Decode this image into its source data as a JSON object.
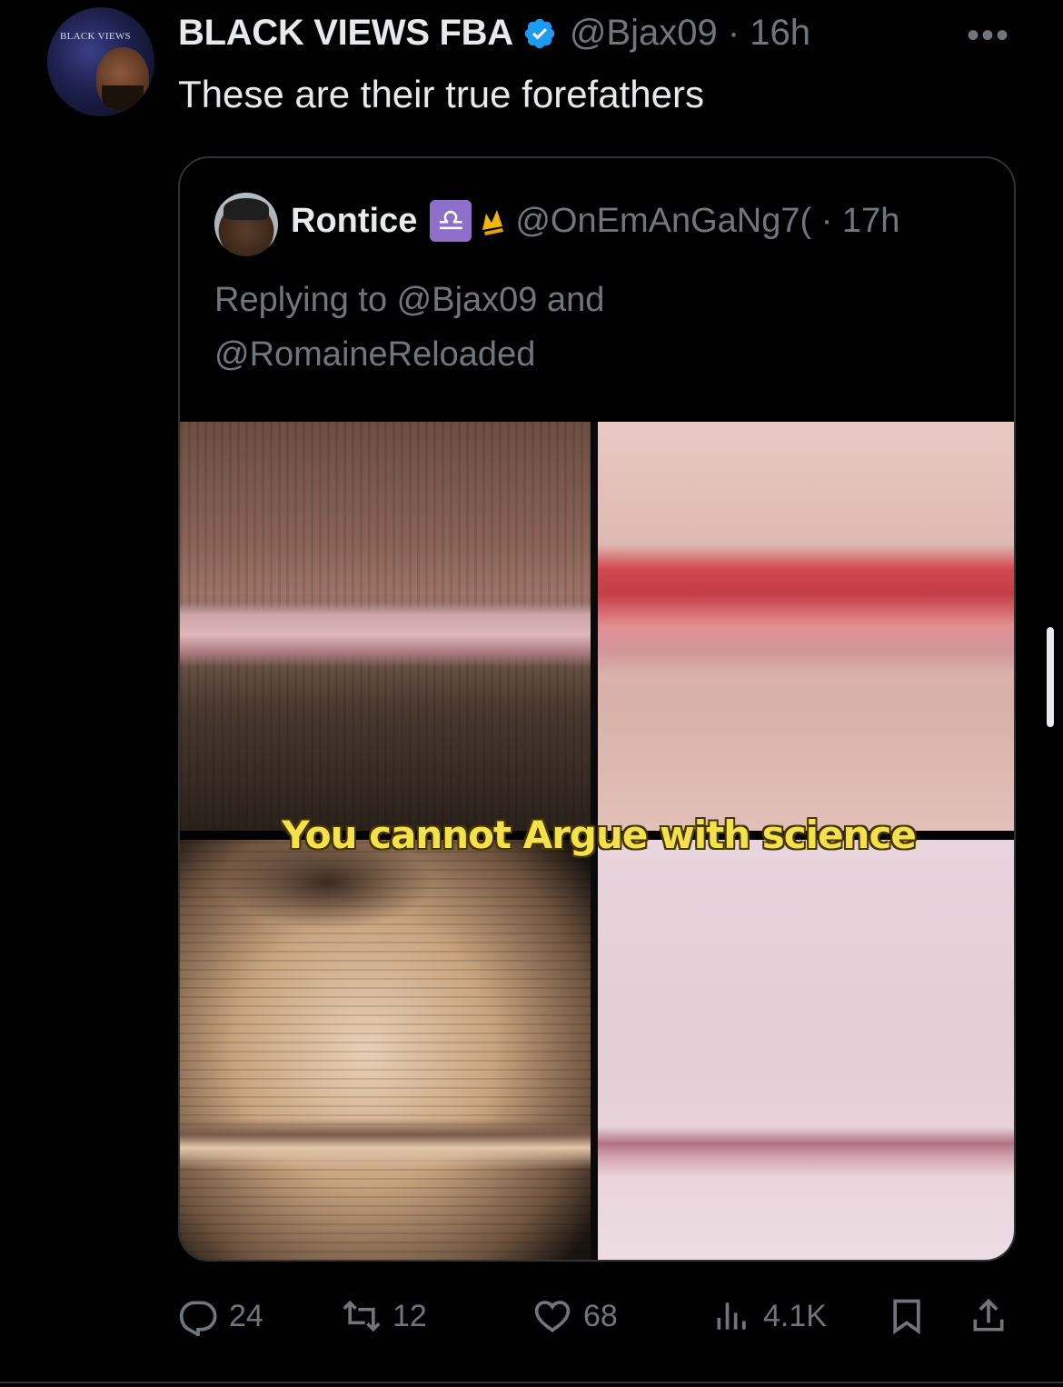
{
  "tweet": {
    "avatar_text": "BLACK VIEWS",
    "author_name": "BLACK VIEWS FBA",
    "handle_time": "@Bjax09 · 16h",
    "more_label": "•••",
    "text": "These are their true forefathers"
  },
  "quoted": {
    "author_name": "Rontice",
    "badge": "♎",
    "handle_time": "@OnEmAnGaNg7( · 17h",
    "replying_line1": "Replying to @Bjax09 and",
    "replying_line2": "@RomaineReloaded",
    "image_caption": "You cannot Argue with science"
  },
  "actions": {
    "replies": "24",
    "retweets": "12",
    "likes": "68",
    "views": "4.1K"
  },
  "colors": {
    "background": "#000000",
    "text": "#e7e9ea",
    "secondary": "#71767b",
    "border": "#2f3336",
    "verified": "#1d9bf0"
  }
}
